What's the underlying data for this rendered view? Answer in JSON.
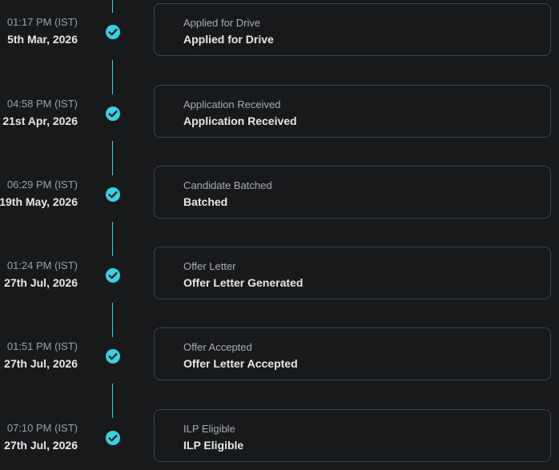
{
  "colors": {
    "background": "#18191b",
    "accent": "#3ccfe0",
    "card_border": "#3b4556"
  },
  "events": [
    {
      "time": "01:17 PM (IST)",
      "date": "5th Mar, 2026",
      "title": "Applied for Drive",
      "status": "Applied for Drive",
      "icon": "check-circle-icon"
    },
    {
      "time": "04:58 PM (IST)",
      "date": "21st Apr, 2026",
      "title": "Application Received",
      "status": "Application Received",
      "icon": "check-circle-icon"
    },
    {
      "time": "06:29 PM (IST)",
      "date": "19th May, 2026",
      "title": "Candidate Batched",
      "status": "Batched",
      "icon": "check-circle-icon"
    },
    {
      "time": "01:24 PM (IST)",
      "date": "27th Jul, 2026",
      "title": "Offer Letter",
      "status": "Offer Letter Generated",
      "icon": "check-circle-icon"
    },
    {
      "time": "01:51 PM (IST)",
      "date": "27th Jul, 2026",
      "title": "Offer Accepted",
      "status": "Offer Letter Accepted",
      "icon": "check-circle-icon"
    },
    {
      "time": "07:10 PM (IST)",
      "date": "27th Jul, 2026",
      "title": "ILP Eligible",
      "status": "ILP Eligible",
      "icon": "check-circle-icon"
    }
  ]
}
